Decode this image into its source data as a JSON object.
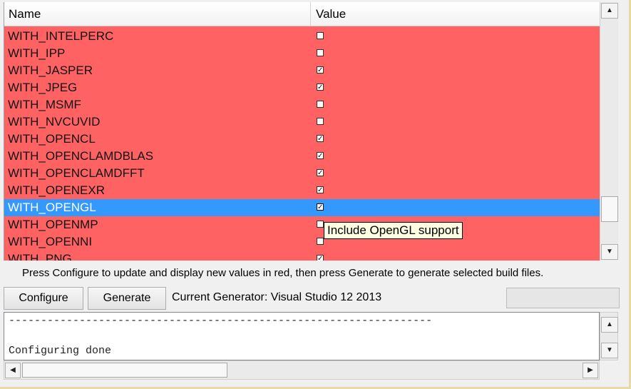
{
  "table": {
    "header_name": "Name",
    "header_value": "Value",
    "rows": [
      {
        "name": "WITH_INTELPERC",
        "checked": false
      },
      {
        "name": "WITH_IPP",
        "checked": false
      },
      {
        "name": "WITH_JASPER",
        "checked": true
      },
      {
        "name": "WITH_JPEG",
        "checked": true
      },
      {
        "name": "WITH_MSMF",
        "checked": false
      },
      {
        "name": "WITH_NVCUVID",
        "checked": false
      },
      {
        "name": "WITH_OPENCL",
        "checked": true
      },
      {
        "name": "WITH_OPENCLAMDBLAS",
        "checked": true
      },
      {
        "name": "WITH_OPENCLAMDFFT",
        "checked": true
      },
      {
        "name": "WITH_OPENEXR",
        "checked": true
      },
      {
        "name": "WITH_OPENGL",
        "checked": true,
        "selected": true
      },
      {
        "name": "WITH_OPENMP",
        "checked": false
      },
      {
        "name": "WITH_OPENNI",
        "checked": false
      },
      {
        "name": "WITH_PNG",
        "checked": true
      }
    ],
    "tooltip": "Include OpenGL support"
  },
  "hint_text": "Press Configure to update and display new values in red, then press Generate to generate selected build files.",
  "buttons": {
    "configure_label": "Configure",
    "generate_label": "Generate"
  },
  "generator_label": "Current Generator: Visual Studio 12 2013",
  "log": {
    "line1": "------------------------------------------------------------------",
    "line2": "Configuring done"
  },
  "colors": {
    "new_value_row": "#ff6262",
    "selected_row": "#3399ff"
  }
}
